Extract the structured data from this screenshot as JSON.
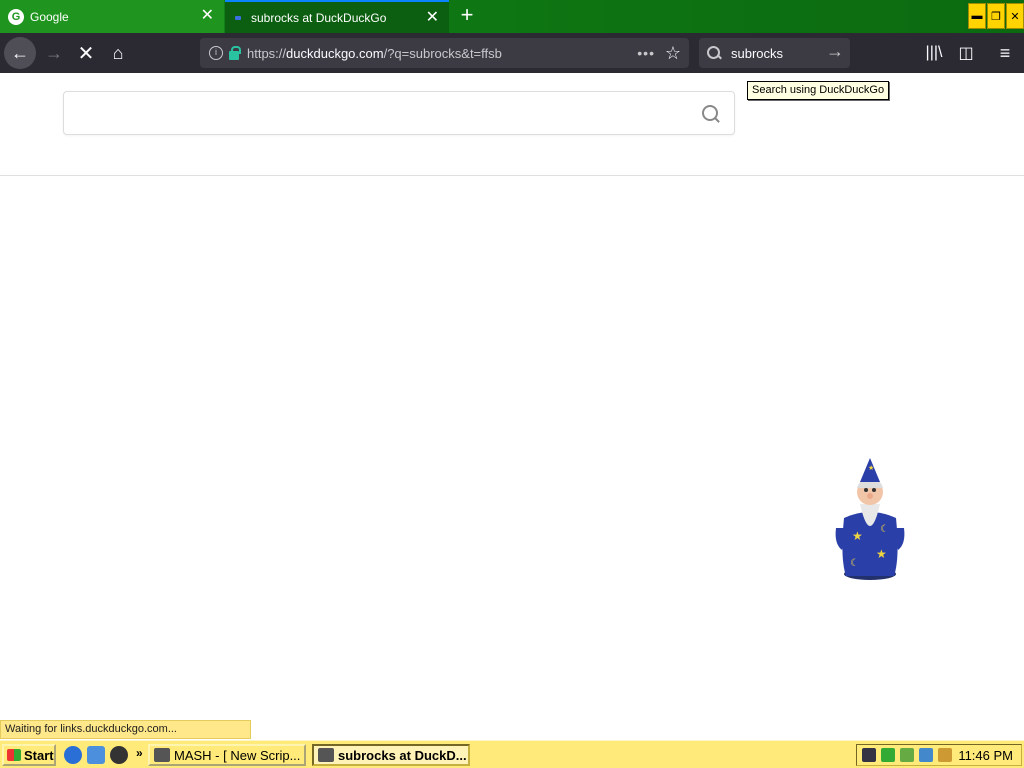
{
  "tabs": [
    {
      "title": "Google",
      "favicon": "google-g-icon"
    },
    {
      "title": "subrocks at DuckDuckGo",
      "favicon": "duckduckgo-icon",
      "active": true
    }
  ],
  "window": {
    "min": "▬",
    "restore": "❐",
    "close": "✕"
  },
  "nav": {
    "url_host": "duckduckgo.com",
    "url_prefix": "https://",
    "url_rest": "/?q=subrocks&t=ffsb",
    "search_value": "subrocks",
    "more": "•••"
  },
  "tooltip": "Search using DuckDuckGo",
  "page": {
    "search_value": ""
  },
  "status": "Waiting for links.duckduckgo.com...",
  "taskbar": {
    "start": "Start",
    "chevron": "»",
    "tasks": [
      {
        "label": "MASH - [ New Scrip..."
      },
      {
        "label": "subrocks at DuckD...",
        "active": true
      }
    ],
    "clock": "11:46 PM"
  },
  "colors": {
    "tabstrip": "#0f7a14",
    "navbar": "#2b2a33",
    "taskbar": "#ffea7a",
    "status": "#ffe88a"
  }
}
